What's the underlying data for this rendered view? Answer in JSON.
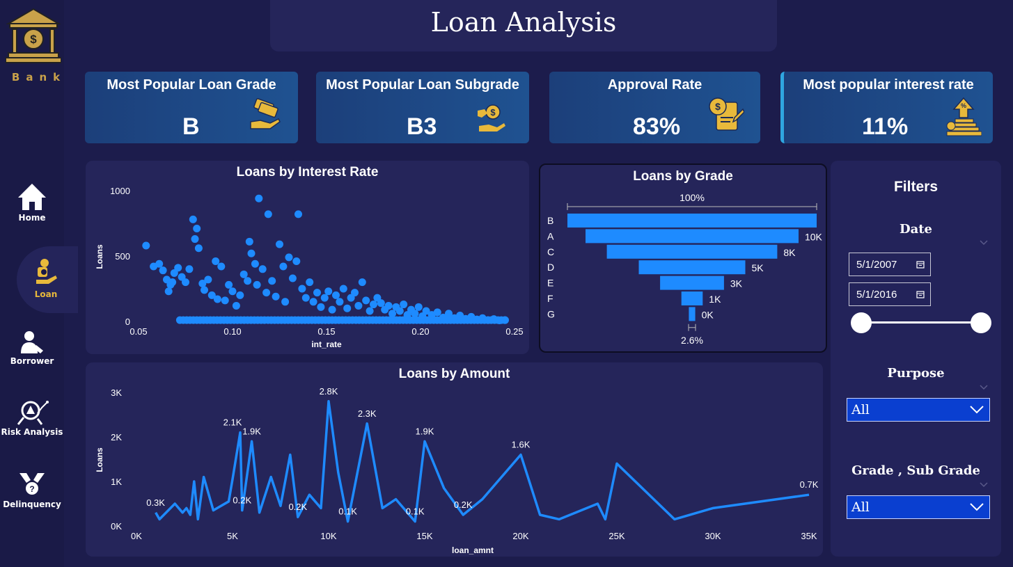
{
  "app": {
    "title": "Loan Analysis",
    "brand": "Bank",
    "accent_color": "#1e8bff",
    "gold_color": "#e8b93b"
  },
  "sidebar": {
    "items": [
      {
        "label": "Home",
        "icon": "home-icon"
      },
      {
        "label": "Loan",
        "icon": "loan-icon",
        "active": true
      },
      {
        "label": "Borrower",
        "icon": "borrower-icon"
      },
      {
        "label": "Risk Analysis",
        "icon": "risk-icon"
      },
      {
        "label": "Delinquency",
        "icon": "delinquency-icon"
      }
    ]
  },
  "kpis": [
    {
      "title": "Most Popular Loan Grade",
      "value": "B",
      "icon": "money-hand-icon"
    },
    {
      "title": "Most Popular Loan Subgrade",
      "value": "B3",
      "icon": "coin-hand-icon"
    },
    {
      "title": "Approval Rate",
      "value": "83%",
      "icon": "document-coin-icon"
    },
    {
      "title": "Most popular interest rate",
      "value": "11%",
      "icon": "coin-stack-icon"
    }
  ],
  "filters": {
    "title": "Filters",
    "date_label": "Date",
    "date_start": "5/1/2007",
    "date_end": "5/1/2016",
    "purpose_label": "Purpose",
    "purpose_value": "All",
    "grade_label": "Grade , Sub Grade",
    "grade_value": "All"
  },
  "chart_data": [
    {
      "type": "scatter",
      "title": "Loans by Interest Rate",
      "xlabel": "int_rate",
      "ylabel": "Loans",
      "xlim": [
        0.05,
        0.25
      ],
      "ylim": [
        0,
        1000
      ],
      "x_ticks": [
        "0.05",
        "0.10",
        "0.15",
        "0.20",
        "0.25"
      ],
      "y_ticks": [
        "0",
        "500",
        "1000"
      ],
      "points": [
        [
          0.054,
          580
        ],
        [
          0.058,
          420
        ],
        [
          0.061,
          440
        ],
        [
          0.063,
          390
        ],
        [
          0.065,
          320
        ],
        [
          0.066,
          230
        ],
        [
          0.067,
          280
        ],
        [
          0.068,
          300
        ],
        [
          0.069,
          370
        ],
        [
          0.071,
          410
        ],
        [
          0.073,
          340
        ],
        [
          0.075,
          300
        ],
        [
          0.077,
          400
        ],
        [
          0.079,
          780
        ],
        [
          0.08,
          630
        ],
        [
          0.081,
          710
        ],
        [
          0.082,
          560
        ],
        [
          0.084,
          290
        ],
        [
          0.085,
          240
        ],
        [
          0.087,
          320
        ],
        [
          0.089,
          200
        ],
        [
          0.091,
          460
        ],
        [
          0.092,
          170
        ],
        [
          0.094,
          420
        ],
        [
          0.096,
          160
        ],
        [
          0.098,
          280
        ],
        [
          0.1,
          230
        ],
        [
          0.102,
          120
        ],
        [
          0.104,
          200
        ],
        [
          0.106,
          360
        ],
        [
          0.108,
          310
        ],
        [
          0.109,
          610
        ],
        [
          0.11,
          520
        ],
        [
          0.112,
          440
        ],
        [
          0.113,
          280
        ],
        [
          0.114,
          940
        ],
        [
          0.116,
          400
        ],
        [
          0.118,
          220
        ],
        [
          0.119,
          820
        ],
        [
          0.121,
          310
        ],
        [
          0.123,
          190
        ],
        [
          0.125,
          590
        ],
        [
          0.127,
          420
        ],
        [
          0.128,
          150
        ],
        [
          0.13,
          490
        ],
        [
          0.132,
          330
        ],
        [
          0.134,
          460
        ],
        [
          0.135,
          820
        ],
        [
          0.137,
          250
        ],
        [
          0.139,
          180
        ],
        [
          0.141,
          300
        ],
        [
          0.143,
          150
        ],
        [
          0.145,
          220
        ],
        [
          0.147,
          110
        ],
        [
          0.149,
          180
        ],
        [
          0.151,
          230
        ],
        [
          0.153,
          90
        ],
        [
          0.155,
          200
        ],
        [
          0.157,
          150
        ],
        [
          0.159,
          250
        ],
        [
          0.161,
          100
        ],
        [
          0.163,
          180
        ],
        [
          0.165,
          220
        ],
        [
          0.167,
          120
        ],
        [
          0.169,
          300
        ],
        [
          0.171,
          160
        ],
        [
          0.173,
          80
        ],
        [
          0.175,
          130
        ],
        [
          0.177,
          180
        ],
        [
          0.179,
          140
        ],
        [
          0.181,
          90
        ],
        [
          0.183,
          120
        ],
        [
          0.185,
          60
        ],
        [
          0.187,
          110
        ],
        [
          0.189,
          80
        ],
        [
          0.191,
          130
        ],
        [
          0.193,
          50
        ],
        [
          0.195,
          90
        ],
        [
          0.197,
          60
        ],
        [
          0.199,
          110
        ],
        [
          0.201,
          40
        ],
        [
          0.203,
          80
        ],
        [
          0.206,
          50
        ],
        [
          0.209,
          70
        ],
        [
          0.212,
          30
        ],
        [
          0.215,
          60
        ],
        [
          0.218,
          25
        ],
        [
          0.221,
          45
        ],
        [
          0.224,
          20
        ],
        [
          0.227,
          35
        ],
        [
          0.23,
          15
        ],
        [
          0.233,
          25
        ],
        [
          0.236,
          10
        ],
        [
          0.239,
          18
        ],
        [
          0.242,
          8
        ],
        [
          0.245,
          10
        ]
      ]
    },
    {
      "type": "bar",
      "title": "Loans by Grade",
      "categories": [
        "B",
        "A",
        "C",
        "D",
        "E",
        "F",
        "G"
      ],
      "values": [
        11700,
        10000,
        8000,
        5000,
        3000,
        1000,
        300
      ],
      "labels": [
        "",
        "10K",
        "8K",
        "5K",
        "3K",
        "1K",
        "0K"
      ],
      "top_label": "100%",
      "bottom_label": "2.6%"
    },
    {
      "type": "line",
      "title": "Loans by Amount",
      "xlabel": "loan_amnt",
      "ylabel": "Loans",
      "xlim": [
        0,
        35000
      ],
      "ylim": [
        0,
        3000
      ],
      "x_ticks": [
        "0K",
        "5K",
        "10K",
        "15K",
        "20K",
        "25K",
        "30K",
        "35K"
      ],
      "y_ticks": [
        "0K",
        "1K",
        "2K",
        "3K"
      ],
      "x": [
        1000,
        1200,
        2000,
        2400,
        2600,
        2800,
        3000,
        3200,
        3500,
        4000,
        4200,
        4800,
        5000,
        5400,
        5500,
        6000,
        6400,
        7000,
        7500,
        8000,
        8400,
        9000,
        9600,
        10000,
        10500,
        11000,
        12000,
        12800,
        13500,
        14500,
        15000,
        16000,
        17000,
        18000,
        20000,
        21000,
        22000,
        24000,
        24400,
        25000,
        28000,
        30000,
        35000
      ],
      "y": [
        300,
        150,
        500,
        300,
        400,
        250,
        1000,
        150,
        1100,
        350,
        400,
        550,
        1050,
        2100,
        350,
        1900,
        300,
        1100,
        450,
        1600,
        200,
        700,
        400,
        2800,
        1200,
        100,
        2300,
        400,
        600,
        100,
        1900,
        850,
        250,
        600,
        1600,
        250,
        150,
        500,
        150,
        1400,
        150,
        400,
        700
      ],
      "annotations": [
        {
          "x": 1000,
          "y": 300,
          "text": "0.3K"
        },
        {
          "x": 5000,
          "y": 2100,
          "text": "2.1K"
        },
        {
          "x": 6000,
          "y": 1900,
          "text": "1.9K"
        },
        {
          "x": 5500,
          "y": 350,
          "text": "0.2K"
        },
        {
          "x": 8400,
          "y": 200,
          "text": "0.2K"
        },
        {
          "x": 10000,
          "y": 2800,
          "text": "2.8K"
        },
        {
          "x": 11000,
          "y": 100,
          "text": "0.1K"
        },
        {
          "x": 12000,
          "y": 2300,
          "text": "2.3K"
        },
        {
          "x": 14500,
          "y": 100,
          "text": "0.1K"
        },
        {
          "x": 15000,
          "y": 1900,
          "text": "1.9K"
        },
        {
          "x": 17000,
          "y": 250,
          "text": "0.2K"
        },
        {
          "x": 20000,
          "y": 1600,
          "text": "1.6K"
        },
        {
          "x": 35000,
          "y": 700,
          "text": "0.7K"
        }
      ]
    }
  ]
}
